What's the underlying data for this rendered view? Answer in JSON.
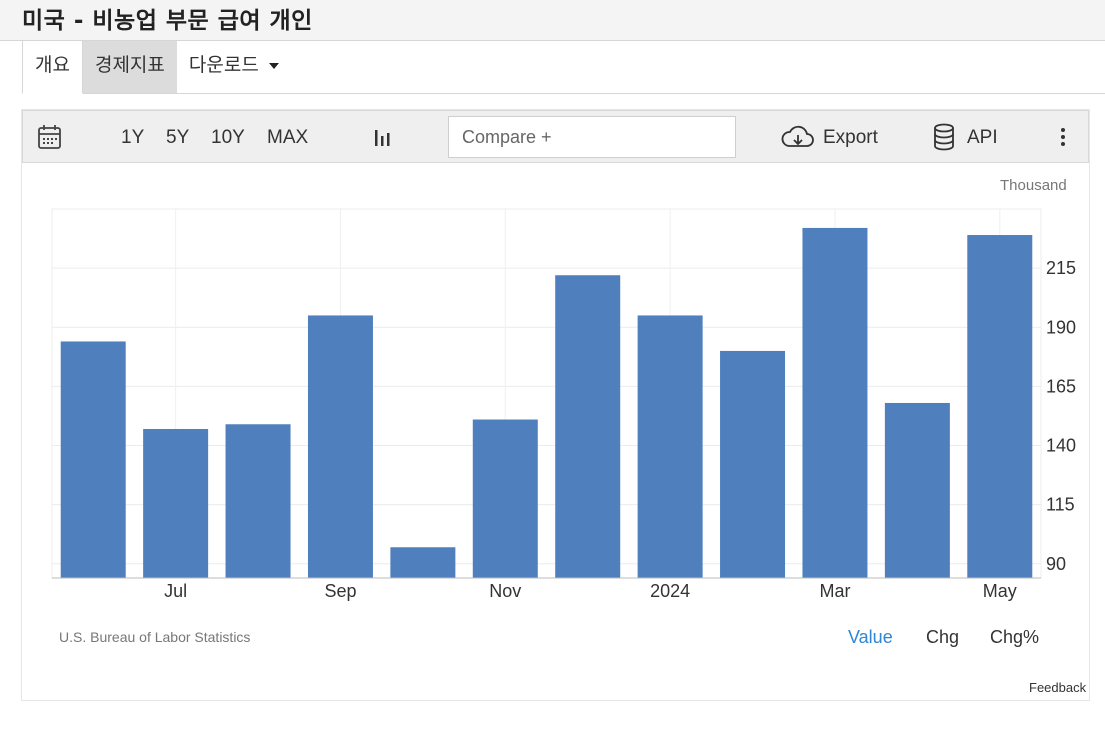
{
  "page": {
    "title": "미국 - 비농업 부문 급여 개인"
  },
  "tabs": [
    {
      "label": "개요"
    },
    {
      "label": "경제지표"
    },
    {
      "label": "다운로드"
    }
  ],
  "toolbar": {
    "ranges": [
      "1Y",
      "5Y",
      "10Y",
      "MAX"
    ],
    "compare_placeholder": "Compare +",
    "export_label": "Export",
    "api_label": "API"
  },
  "chart_data": {
    "type": "bar",
    "unit_label": "Thousand",
    "x": [
      "2023-06",
      "2023-07",
      "2023-08",
      "2023-09",
      "2023-10",
      "2023-11",
      "2023-12",
      "2024-01",
      "2024-02",
      "2024-03",
      "2024-04",
      "2024-05"
    ],
    "values": [
      184,
      147,
      149,
      195,
      97,
      151,
      212,
      195,
      180,
      232,
      158,
      229
    ],
    "x_tick_labels": [
      {
        "index": 1,
        "label": "Jul"
      },
      {
        "index": 3,
        "label": "Sep"
      },
      {
        "index": 5,
        "label": "Nov"
      },
      {
        "index": 7,
        "label": "2024"
      },
      {
        "index": 9,
        "label": "Mar"
      },
      {
        "index": 11,
        "label": "May"
      }
    ],
    "y_ticks": [
      90,
      115,
      140,
      165,
      190,
      215
    ],
    "ylim": [
      84,
      240
    ],
    "y_axis_side": "right",
    "grid": true,
    "bar_color": "#4f80bd"
  },
  "footer": {
    "source": "U.S. Bureau of Labor Statistics",
    "views": [
      "Value",
      "Chg",
      "Chg%"
    ],
    "feedback": "Feedback"
  }
}
